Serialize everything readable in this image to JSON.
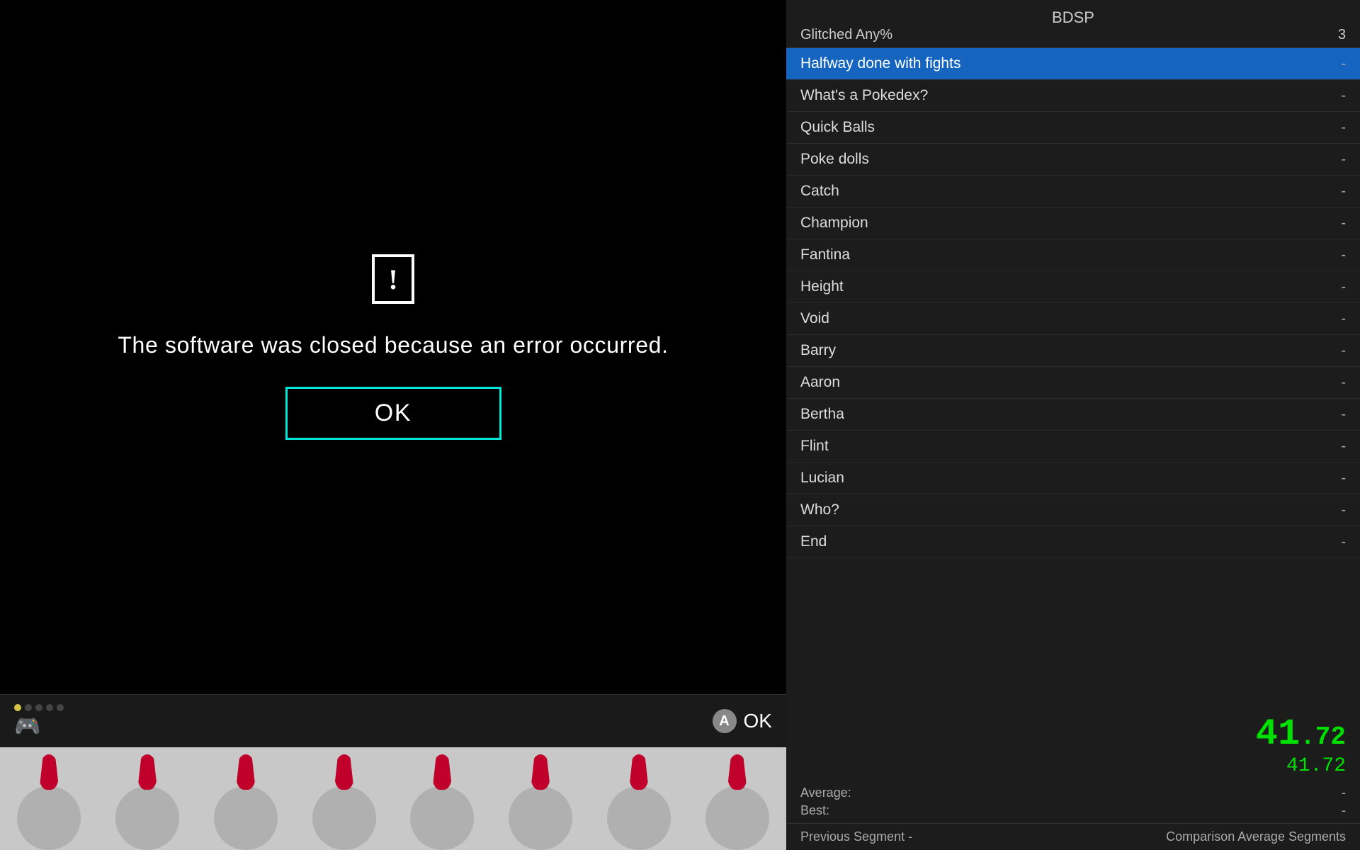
{
  "game_area": {
    "error": {
      "icon": "!",
      "message": "The software was closed because an error occurred.",
      "ok_button_label": "OK"
    },
    "hud": {
      "dots": [
        {
          "color": "yellow"
        },
        {
          "color": "dark"
        },
        {
          "color": "dark"
        },
        {
          "color": "dark"
        },
        {
          "color": "dark"
        }
      ],
      "ok_label": "OK",
      "a_label": "A"
    },
    "pokemon_slots": [
      {},
      {},
      {},
      {},
      {},
      {},
      {},
      {}
    ]
  },
  "right_panel": {
    "header": {
      "game": "BDSP",
      "category": "Glitched Any%",
      "run_count": "3"
    },
    "splits": [
      {
        "label": "Halfway done with fights",
        "time": "-",
        "active": true
      },
      {
        "label": "What's a Pokedex?",
        "time": "-",
        "active": false
      },
      {
        "label": "Quick Balls",
        "time": "-",
        "active": false
      },
      {
        "label": "Poke dolls",
        "time": "-",
        "active": false
      },
      {
        "label": "Catch",
        "time": "-",
        "active": false
      },
      {
        "label": "Champion",
        "time": "-",
        "active": false
      },
      {
        "label": "Fantina",
        "time": "-",
        "active": false
      },
      {
        "label": "Height",
        "time": "-",
        "active": false
      },
      {
        "label": "Void",
        "time": "-",
        "active": false
      },
      {
        "label": "Barry",
        "time": "-",
        "active": false
      },
      {
        "label": "Aaron",
        "time": "-",
        "active": false
      },
      {
        "label": "Bertha",
        "time": "-",
        "active": false
      },
      {
        "label": "Flint",
        "time": "-",
        "active": false
      },
      {
        "label": "Lucian",
        "time": "-",
        "active": false
      },
      {
        "label": "Who?",
        "time": "-",
        "active": false
      },
      {
        "label": "End",
        "time": "-",
        "active": false
      }
    ],
    "timer": {
      "main": "41",
      "decimal": ".72",
      "sub": "41.72"
    },
    "stats": {
      "average_label": "Average:",
      "average_value": "-",
      "best_label": "Best:",
      "best_value": "-"
    },
    "footer": {
      "previous_segment": "Previous Segment",
      "previous_value": "-",
      "comparison": "Comparison",
      "comparison_value": "Average Segments"
    }
  }
}
